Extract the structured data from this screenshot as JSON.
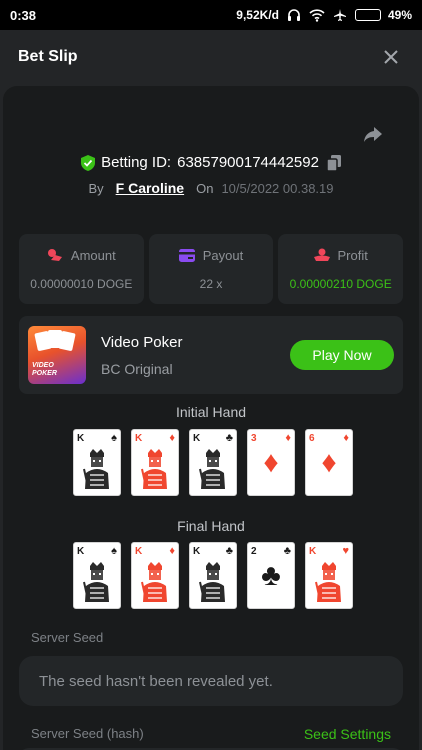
{
  "status_bar": {
    "time": "0:38",
    "speed": "9,52K/d",
    "battery": "49%",
    "battery_level": 0.49
  },
  "header": {
    "title": "Bet Slip"
  },
  "bet": {
    "id_label": "Betting ID:",
    "id_value": "63857900174442592",
    "by_label": "By",
    "user": "F Caroline",
    "on_label": "On",
    "date": "10/5/2022 00.38.19"
  },
  "stats": [
    {
      "label": "Amount",
      "value": "0.00000010 DOGE",
      "icon": "amount-icon"
    },
    {
      "label": "Payout",
      "value": "22 x",
      "icon": "payout-icon"
    },
    {
      "label": "Profit",
      "value": "0.00000210 DOGE",
      "icon": "profit-icon"
    }
  ],
  "game": {
    "thumb_text": "VIDEO\nPOKER",
    "thumb_line1": "VIDEO",
    "thumb_line2": "POKER",
    "name": "Video Poker",
    "provider": "BC Original",
    "play_label": "Play Now"
  },
  "initial_hand": {
    "title": "Initial Hand",
    "cards": [
      {
        "rank": "K",
        "suit": "♠",
        "color": "black",
        "face": true
      },
      {
        "rank": "K",
        "suit": "♦",
        "color": "red",
        "face": true
      },
      {
        "rank": "K",
        "suit": "♣",
        "color": "black",
        "face": true
      },
      {
        "rank": "3",
        "suit": "♦",
        "color": "red",
        "face": false
      },
      {
        "rank": "6",
        "suit": "♦",
        "color": "red",
        "face": false
      }
    ]
  },
  "final_hand": {
    "title": "Final Hand",
    "cards": [
      {
        "rank": "K",
        "suit": "♠",
        "color": "black",
        "face": true
      },
      {
        "rank": "K",
        "suit": "♦",
        "color": "red",
        "face": true
      },
      {
        "rank": "K",
        "suit": "♣",
        "color": "black",
        "face": true
      },
      {
        "rank": "2",
        "suit": "♣",
        "color": "black",
        "face": false
      },
      {
        "rank": "K",
        "suit": "♥",
        "color": "red",
        "face": true
      }
    ]
  },
  "seed": {
    "server_seed_label": "Server Seed",
    "server_seed_value": "The seed hasn't been revealed yet.",
    "hash_label": "Server Seed (hash)",
    "settings_label": "Seed Settings"
  },
  "colors": {
    "accent_green": "#3bc117",
    "shield_green": "#3bc117",
    "amount_icon": "#f0465a",
    "payout_icon": "#8a4bf0",
    "profit_icon": "#f0465a"
  }
}
